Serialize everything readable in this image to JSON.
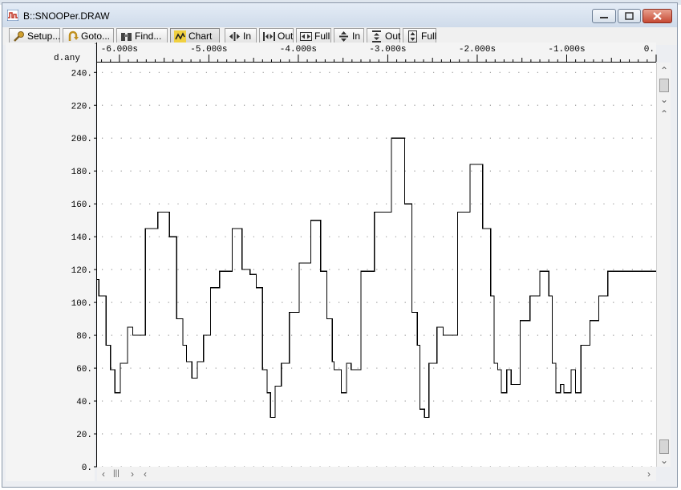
{
  "window": {
    "title": "B::SNOOPer.DRAW"
  },
  "toolbar": [
    {
      "label": "Setup...",
      "icon": "wrench-icon"
    },
    {
      "label": "Goto...",
      "icon": "goto-icon"
    },
    {
      "label": "Find...",
      "icon": "binoculars-icon"
    },
    {
      "label": "Chart",
      "icon": "chart-icon"
    },
    {
      "label": "In",
      "icon": "zoom-in-horizontal-icon"
    },
    {
      "label": "Out",
      "icon": "zoom-out-horizontal-icon"
    },
    {
      "label": "Full",
      "icon": "zoom-full-horizontal-icon"
    },
    {
      "label": "In",
      "icon": "zoom-in-vertical-icon"
    },
    {
      "label": "Out",
      "icon": "zoom-out-vertical-icon"
    },
    {
      "label": "Full",
      "icon": "zoom-full-vertical-icon"
    }
  ],
  "chart_data": {
    "type": "line",
    "step": true,
    "ylabel": "d.any",
    "xlim": [
      -6.25,
      0.0
    ],
    "ylim": [
      0,
      246
    ],
    "x_ticks": [
      -6.0,
      -5.0,
      -4.0,
      -3.0,
      -2.0,
      -1.0,
      0.0
    ],
    "x_tick_labels": [
      "-6.000s",
      "-5.000s",
      "-4.000s",
      "-3.000s",
      "-2.000s",
      "-1.000s",
      "0."
    ],
    "y_ticks": [
      0,
      20,
      40,
      60,
      80,
      100,
      120,
      140,
      160,
      180,
      200,
      220,
      240
    ],
    "y_tick_labels": [
      "0.",
      "20.",
      "40.",
      "60.",
      "80.",
      "100.",
      "120.",
      "140.",
      "160.",
      "180.",
      "200.",
      "220.",
      "240."
    ],
    "grid": "dotted",
    "line_color": "#000000",
    "series": [
      {
        "points": [
          [
            -6.25,
            114
          ],
          [
            -6.23,
            104
          ],
          [
            -6.15,
            74
          ],
          [
            -6.1,
            59
          ],
          [
            -6.05,
            45
          ],
          [
            -5.99,
            63
          ],
          [
            -5.91,
            85
          ],
          [
            -5.85,
            80
          ],
          [
            -5.71,
            145
          ],
          [
            -5.57,
            155
          ],
          [
            -5.44,
            140
          ],
          [
            -5.36,
            90
          ],
          [
            -5.29,
            74
          ],
          [
            -5.25,
            64
          ],
          [
            -5.19,
            54
          ],
          [
            -5.13,
            64
          ],
          [
            -5.06,
            80
          ],
          [
            -4.98,
            109
          ],
          [
            -4.88,
            119
          ],
          [
            -4.74,
            145
          ],
          [
            -4.63,
            120
          ],
          [
            -4.54,
            117
          ],
          [
            -4.47,
            109
          ],
          [
            -4.4,
            59
          ],
          [
            -4.35,
            45
          ],
          [
            -4.31,
            30
          ],
          [
            -4.26,
            49
          ],
          [
            -4.19,
            63
          ],
          [
            -4.1,
            94
          ],
          [
            -3.99,
            124
          ],
          [
            -3.86,
            150
          ],
          [
            -3.75,
            119
          ],
          [
            -3.68,
            90
          ],
          [
            -3.62,
            64
          ],
          [
            -3.6,
            59
          ],
          [
            -3.52,
            45
          ],
          [
            -3.46,
            63
          ],
          [
            -3.41,
            59
          ],
          [
            -3.3,
            119
          ],
          [
            -3.15,
            155
          ],
          [
            -2.96,
            200
          ],
          [
            -2.81,
            160
          ],
          [
            -2.73,
            94
          ],
          [
            -2.67,
            74
          ],
          [
            -2.64,
            35
          ],
          [
            -2.59,
            30
          ],
          [
            -2.54,
            63
          ],
          [
            -2.45,
            85
          ],
          [
            -2.38,
            80
          ],
          [
            -2.22,
            155
          ],
          [
            -2.08,
            184
          ],
          [
            -1.94,
            145
          ],
          [
            -1.85,
            104
          ],
          [
            -1.81,
            63
          ],
          [
            -1.77,
            59
          ],
          [
            -1.73,
            45
          ],
          [
            -1.67,
            59
          ],
          [
            -1.62,
            50
          ],
          [
            -1.52,
            89
          ],
          [
            -1.41,
            104
          ],
          [
            -1.3,
            119
          ],
          [
            -1.2,
            104
          ],
          [
            -1.16,
            63
          ],
          [
            -1.12,
            45
          ],
          [
            -1.07,
            50
          ],
          [
            -1.03,
            45
          ],
          [
            -0.95,
            59
          ],
          [
            -0.9,
            45
          ],
          [
            -0.84,
            74
          ],
          [
            -0.74,
            89
          ],
          [
            -0.64,
            104
          ],
          [
            -0.54,
            119
          ],
          [
            -0.43,
            119
          ]
        ]
      }
    ]
  }
}
